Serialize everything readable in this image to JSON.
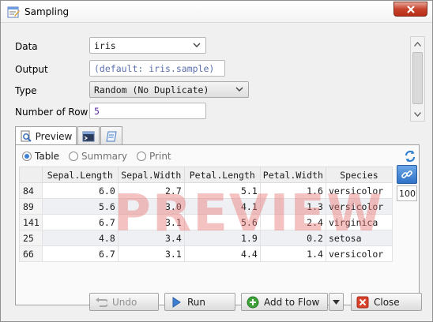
{
  "window": {
    "title": "Sampling"
  },
  "form": {
    "data": {
      "label": "Data",
      "value": "iris"
    },
    "output": {
      "label": "Output",
      "placeholder": "(default: iris.sample)"
    },
    "type": {
      "label": "Type",
      "value": "Random (No Duplicate)"
    },
    "rows": {
      "label": "Number of Row",
      "value": "5"
    }
  },
  "tabs": [
    {
      "label": "Preview"
    }
  ],
  "view_options": {
    "table": "Table",
    "summary": "Summary",
    "print": "Print",
    "selected": "Table"
  },
  "table": {
    "columns": [
      "Sepal.Length",
      "Sepal.Width",
      "Petal.Length",
      "Petal.Width",
      "Species"
    ],
    "rows": [
      {
        "id": "84",
        "cells": [
          "6.0",
          "2.7",
          "5.1",
          "1.6",
          "versicolor"
        ]
      },
      {
        "id": "89",
        "cells": [
          "5.6",
          "3.0",
          "4.1",
          "1.3",
          "versicolor"
        ]
      },
      {
        "id": "141",
        "cells": [
          "6.7",
          "3.1",
          "5.6",
          "2.4",
          "virginica"
        ]
      },
      {
        "id": "25",
        "cells": [
          "4.8",
          "3.4",
          "1.9",
          "0.2",
          "setosa"
        ]
      },
      {
        "id": "66",
        "cells": [
          "6.7",
          "3.1",
          "4.4",
          "1.4",
          "versicolor"
        ]
      }
    ]
  },
  "watermark": "PREVIEW",
  "preview_limit": "100",
  "buttons": {
    "undo": "Undo",
    "run": "Run",
    "add_to_flow": "Add to Flow",
    "close": "Close"
  },
  "colors": {
    "accent": "#3c7fd6",
    "watermark": "#e87878",
    "close_red": "#c7432c"
  }
}
